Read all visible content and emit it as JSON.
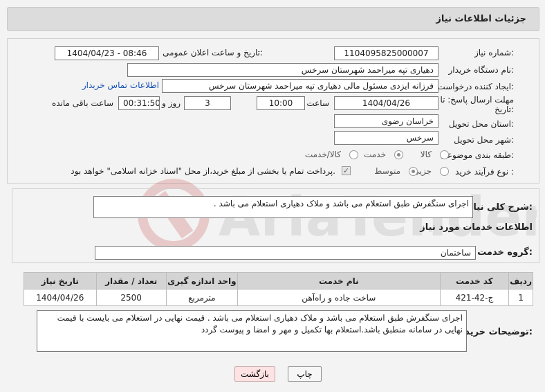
{
  "header": {
    "title": "جزئیات اطلاعات نیاز"
  },
  "form": {
    "need_number": {
      "label": "شماره نیاز:",
      "value": "1104095825000007"
    },
    "announce_datetime": {
      "label": "تاریخ و ساعت اعلان عمومی:",
      "value": "1404/04/23 - 08:46"
    },
    "buyer_org": {
      "label": "نام دستگاه خریدار:",
      "value": "دهیاری تپه میراحمد شهرستان سرخس"
    },
    "creator": {
      "label": "ایجاد کننده درخواست:",
      "value": "فرزانه ایزدی مسئول مالی دهیاری تپه میراحمد شهرستان سرخس",
      "contact_link": "اطلاعات تماس خریدار"
    },
    "deadline": {
      "label": "مهلت ارسال پاسخ: تا تاریخ:",
      "date": "1404/04/26",
      "time_label": "ساعت",
      "time": "10:00",
      "days": "3",
      "days_label": "روز و",
      "remaining": "00:31:50",
      "remaining_label": "ساعت باقی مانده"
    },
    "province": {
      "label": "استان محل تحویل:",
      "value": "خراسان رضوی"
    },
    "city": {
      "label": "شهر محل تحویل:",
      "value": "سرخس"
    },
    "category": {
      "label": "طبقه بندی موضوعی:",
      "options": [
        "کالا",
        "خدمت",
        "کالا/خدمت"
      ],
      "selected": "خدمت"
    },
    "purchase_type": {
      "label": "نوع فرآیند خرید :",
      "options": [
        "جزیی",
        "متوسط"
      ],
      "selected": "متوسط",
      "payment_note": "پرداخت تمام یا بخشی از مبلغ خرید،از محل \"اسناد خزانه اسلامی\" خواهد بود."
    }
  },
  "summary": {
    "label": "شرح کلی نیاز:",
    "value": "اجرای سنگفرش طبق استعلام  می باشد و ملاک دهیاری استعلام می باشد ."
  },
  "services": {
    "section_title": "اطلاعات خدمات مورد نیاز",
    "group_label": "گروه خدمت:",
    "group_value": "ساختمان",
    "table": {
      "headers": [
        "ردیف",
        "کد خدمت",
        "نام خدمت",
        "واحد اندازه گیری",
        "تعداد / مقدار",
        "تاریخ نیاز"
      ],
      "rows": [
        [
          "1",
          "ج-42-421",
          "ساخت جاده و راه‌آهن",
          "مترمربع",
          "2500",
          "1404/04/26"
        ]
      ]
    }
  },
  "buyer_notes": {
    "label": "توضیحات خریدار:",
    "value": "اجرای سنگفرش طبق استعلام  می باشد و ملاک دهیاری استعلام می باشد . قیمت نهایی در استعلام می بایست با قیمت نهایی در سامانه منطبق باشد.استعلام بها تکمیل و مهر و امضا و پیوست گردد"
  },
  "buttons": {
    "print": "چاپ",
    "back": "بازگشت"
  },
  "colors": {
    "header_bg": "#dcdcdc",
    "link": "#1a52b7",
    "table_header_bg": "#d4d4d4",
    "back_button_bg": "#fde3e3"
  }
}
